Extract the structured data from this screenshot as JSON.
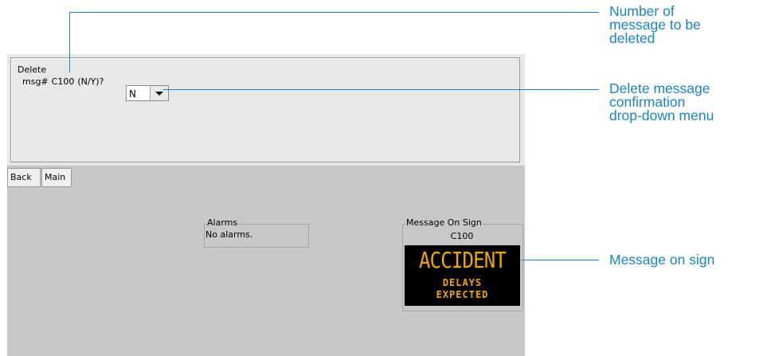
{
  "delete_panel": {
    "group_label": "Delete",
    "prompt_prefix": "msg#",
    "message_number": "C100",
    "prompt_suffix": "(N/Y)?",
    "selected_value": "N"
  },
  "nav": {
    "back_label": "Back",
    "main_label": "Main"
  },
  "alarms": {
    "label": "Alarms",
    "text": "No alarms."
  },
  "sign": {
    "label": "Message On Sign",
    "id": "C100",
    "line1": "ACCIDENT",
    "line2": "DELAYS",
    "line3": "EXPECTED",
    "text_color": "#f0a800"
  },
  "callouts": {
    "number_line1": "Number of",
    "number_line2": "message to be",
    "number_line3": "deleted",
    "confirm_line1": "Delete message",
    "confirm_line2": "confirmation",
    "confirm_line3": "drop-down menu",
    "sign": "Message on sign",
    "color": "#1a84c7"
  }
}
